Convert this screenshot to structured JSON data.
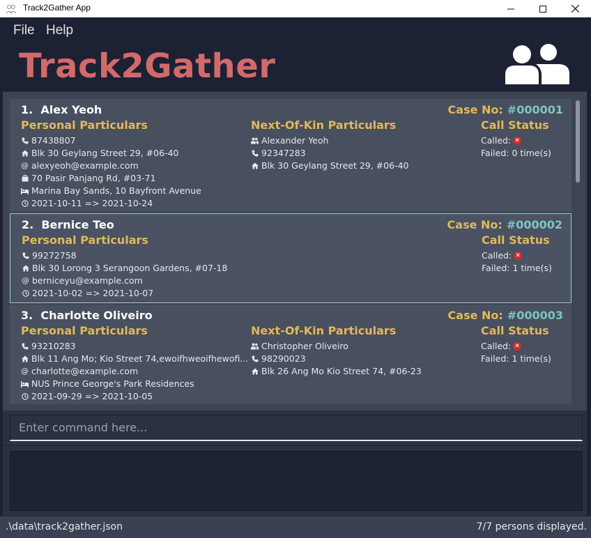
{
  "window": {
    "title": "Track2Gather App"
  },
  "menu": {
    "file": "File",
    "help": "Help"
  },
  "brand": "Track2Gather",
  "persons": [
    {
      "index": "1.",
      "name": "Alex Yeoh",
      "case_label": "Case No:",
      "case_no": "#000001",
      "personal_title": "Personal Particulars",
      "phone": "87438807",
      "home": "Blk 30 Geylang Street 29, #06-40",
      "email": "alexyeoh@example.com",
      "work": "70 Pasir Panjang Rd, #03-71",
      "shn": "Marina Bay Sands, 10 Bayfront Avenue",
      "period": "2021-10-11 => 2021-10-24",
      "nok_title": "Next-Of-Kin Particulars",
      "nok_name": "Alexander Yeoh",
      "nok_phone": "92347283",
      "nok_address": "Blk 30 Geylang Street 29, #06-40",
      "call_title": "Call Status",
      "called": "Called:",
      "failed": "Failed: 0 time(s)"
    },
    {
      "index": "2.",
      "name": "Bernice Teo",
      "case_label": "Case No:",
      "case_no": "#000002",
      "personal_title": "Personal Particulars",
      "phone": "99272758",
      "home": "Blk 30 Lorong 3 Serangoon Gardens, #07-18",
      "email": "berniceyu@example.com",
      "period": "2021-10-02 => 2021-10-07",
      "call_title": "Call Status",
      "called": "Called:",
      "failed": "Failed: 1 time(s)"
    },
    {
      "index": "3.",
      "name": "Charlotte Oliveiro",
      "case_label": "Case No:",
      "case_no": "#000003",
      "personal_title": "Personal Particulars",
      "phone": "93210283",
      "home": "Blk 11 Ang Mo; Kio Street 74,ewoifhweoifhewofi...",
      "email": "charlotte@example.com",
      "shn": "NUS Prince George's Park Residences",
      "period": "2021-09-29 => 2021-10-05",
      "nok_title": "Next-Of-Kin Particulars",
      "nok_name": "Christopher Oliveiro",
      "nok_phone": "98290023",
      "nok_address": "Blk 26 Ang Mo Kio Street 74, #06-23",
      "call_title": "Call Status",
      "called": "Called:",
      "failed": "Failed: 1 time(s)"
    }
  ],
  "command": {
    "placeholder": "Enter command here...",
    "value": ""
  },
  "result": {
    "text": ""
  },
  "status": {
    "path": ".\\data\\track2gather.json",
    "count": "7/7 persons displayed."
  },
  "colors": {
    "accent_title": "#d26a6a",
    "section": "#e2b955",
    "case_number": "#7fc4c6",
    "background": "#1d2134",
    "card": "#484f5f"
  }
}
